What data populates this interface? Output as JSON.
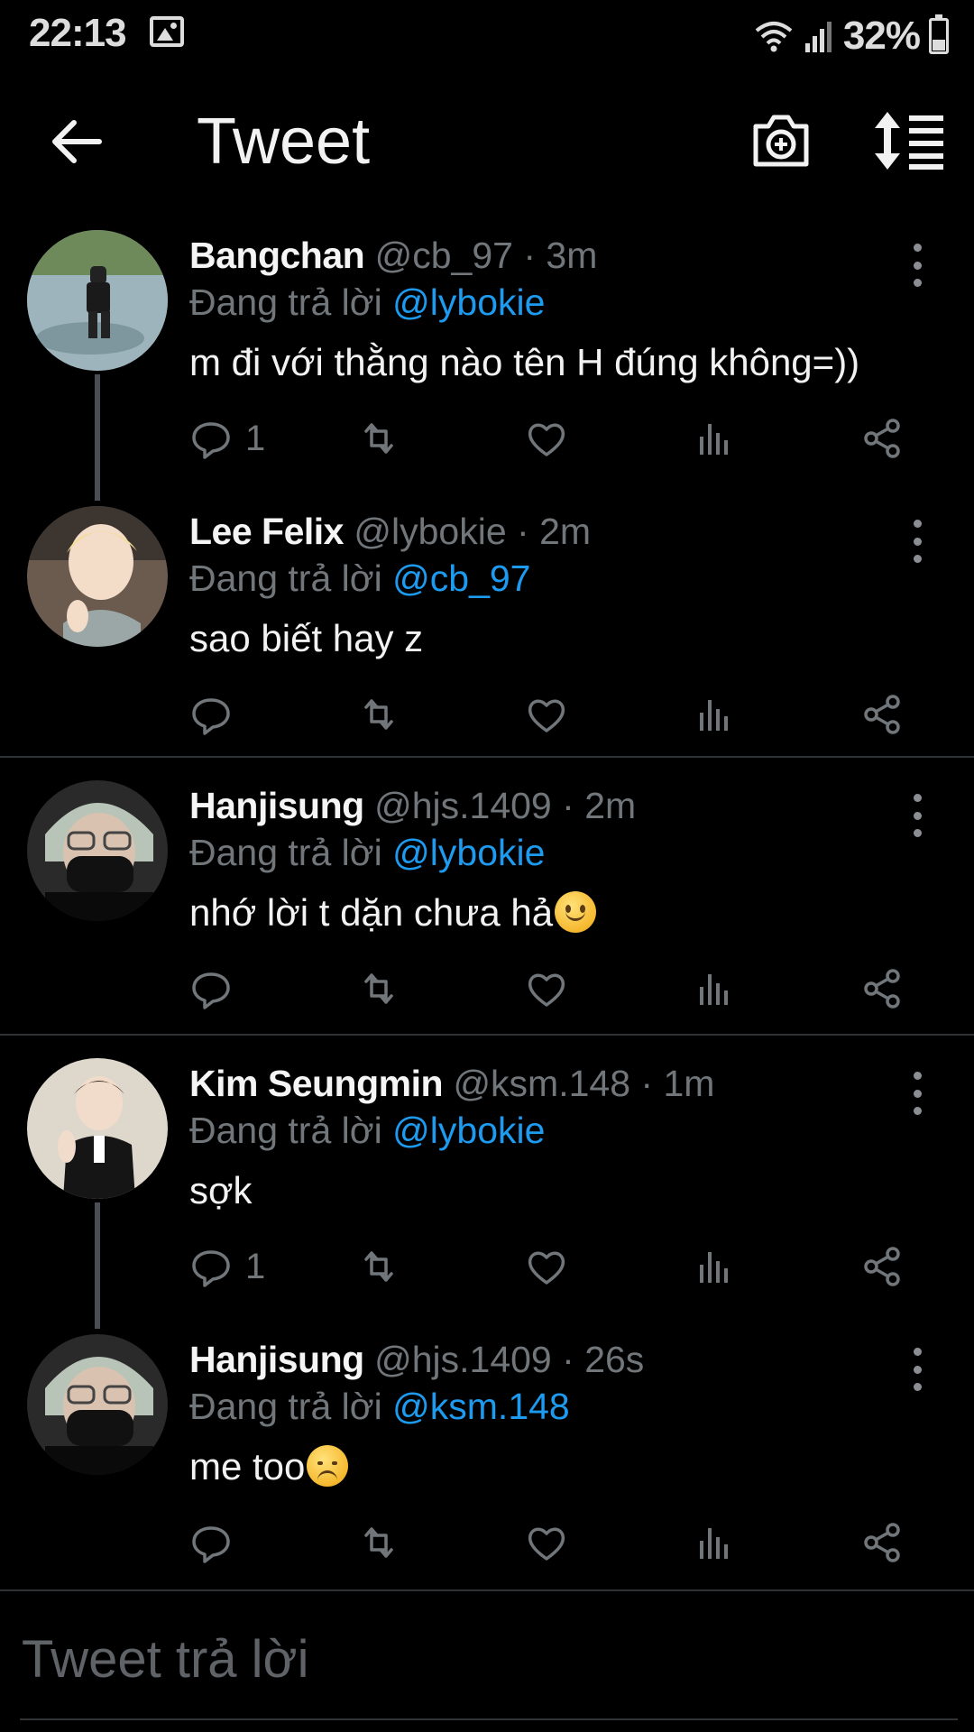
{
  "status_bar": {
    "time": "22:13",
    "battery_percent": "32%"
  },
  "header": {
    "title": "Tweet"
  },
  "tweets": [
    {
      "name": "Bangchan",
      "handle": "@cb_97",
      "sep": "·",
      "time": "3m",
      "reply_prefix": "Đang trả lời",
      "reply_to": "@lybokie",
      "text": "m đi với thằng nào tên H đúng không=))",
      "reply_count": "1"
    },
    {
      "name": "Lee Felix",
      "handle": "@lybokie",
      "sep": "·",
      "time": "2m",
      "reply_prefix": "Đang trả lời",
      "reply_to": "@cb_97",
      "text": "sao biết hay z",
      "reply_count": ""
    },
    {
      "name": "Hanjisung",
      "handle": "@hjs.1409",
      "sep": "·",
      "time": "2m",
      "reply_prefix": "Đang trả lời",
      "reply_to": "@lybokie",
      "text": "nhớ lời t dặn chưa hả",
      "reply_count": ""
    },
    {
      "name": "Kim Seungmin",
      "handle": "@ksm.148",
      "sep": "·",
      "time": "1m",
      "reply_prefix": "Đang trả lời",
      "reply_to": "@lybokie",
      "text": "sợk",
      "reply_count": "1"
    },
    {
      "name": "Hanjisung",
      "handle": "@hjs.1409",
      "sep": "·",
      "time": "26s",
      "reply_prefix": "Đang trả lời",
      "reply_to": "@ksm.148",
      "text": "me too",
      "reply_count": ""
    }
  ],
  "reply_input": {
    "placeholder": "Tweet trả lời"
  },
  "colors": {
    "accent": "#1d9bf0",
    "muted": "#71767b",
    "background": "#000000"
  }
}
